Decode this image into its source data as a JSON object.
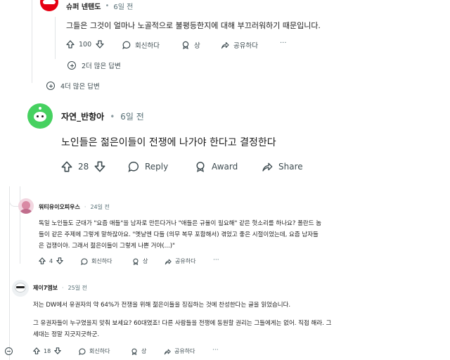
{
  "panel1": {
    "c1": {
      "author": "슈퍼 넨텐도",
      "sep": "•",
      "time": "6일 전",
      "body": "그들은 그것이 얼마나 노골적으로 불평등한지에 대해 부끄러워하기 때문입니다.",
      "votes": "100",
      "reply": "회신하다",
      "award": "상",
      "share": "공유하다",
      "more": "···",
      "more_replies": "2더 많은 답변"
    },
    "outer_more_replies": "4더 많은 답변",
    "c2": {
      "author": "자연_반항아",
      "sep": "•",
      "time": "6일 전",
      "body": "노인들은 젊은이들이 전쟁에 나가야 한다고 결정한다",
      "votes": "28",
      "reply": "Reply",
      "award": "Award",
      "share": "Share"
    }
  },
  "panel2": {
    "c3": {
      "author": "워티유이오피우스",
      "sep": "·",
      "time": "24일 전",
      "body_lines": [
        "독일 노인들도 군대가 \"요즘 애들\"을 남자로 만든다거나 \"애들은 규율이 필요해\" 같은 헛소리를 하나요? 폴란드 놈",
        "들이 같은 주제에 그렇게 말하잖아요. \"옛날엔 다들 (의무 복무 포함해서) 겪었고 좋은 시절이었는데, 요즘 남자들",
        "은 겁쟁이야. 그래서 젊은이들이 그렇게 나쁜 거야(...)\""
      ],
      "votes": "4",
      "reply": "회신하다",
      "award": "상",
      "share": "공유하다",
      "more": "···"
    },
    "c4": {
      "author": "제이7엠보",
      "sep": "·",
      "time": "25일 전",
      "body_lines": [
        "저는 DW에서 유권자의 약 64%가 전쟁을 위해 젊은이들을 징집하는 것에 찬성한다는 글을 읽었습니다.",
        "그 유권자들이 누구였을지 맞춰 보세요? 60대였죠! 다른 사람들을 전쟁에 동원할 권리는 그들에게는 없어. 직접 해라. 그",
        "세대는 정말 지긋지긋하군."
      ],
      "votes": "18",
      "reply": "회신하다",
      "award": "상",
      "share": "공유하다",
      "more": "···"
    }
  },
  "colors": {
    "brand_red": "#e60012",
    "avatar_green": "#46d160",
    "text": "#1c1c1c",
    "muted": "#576f76"
  }
}
